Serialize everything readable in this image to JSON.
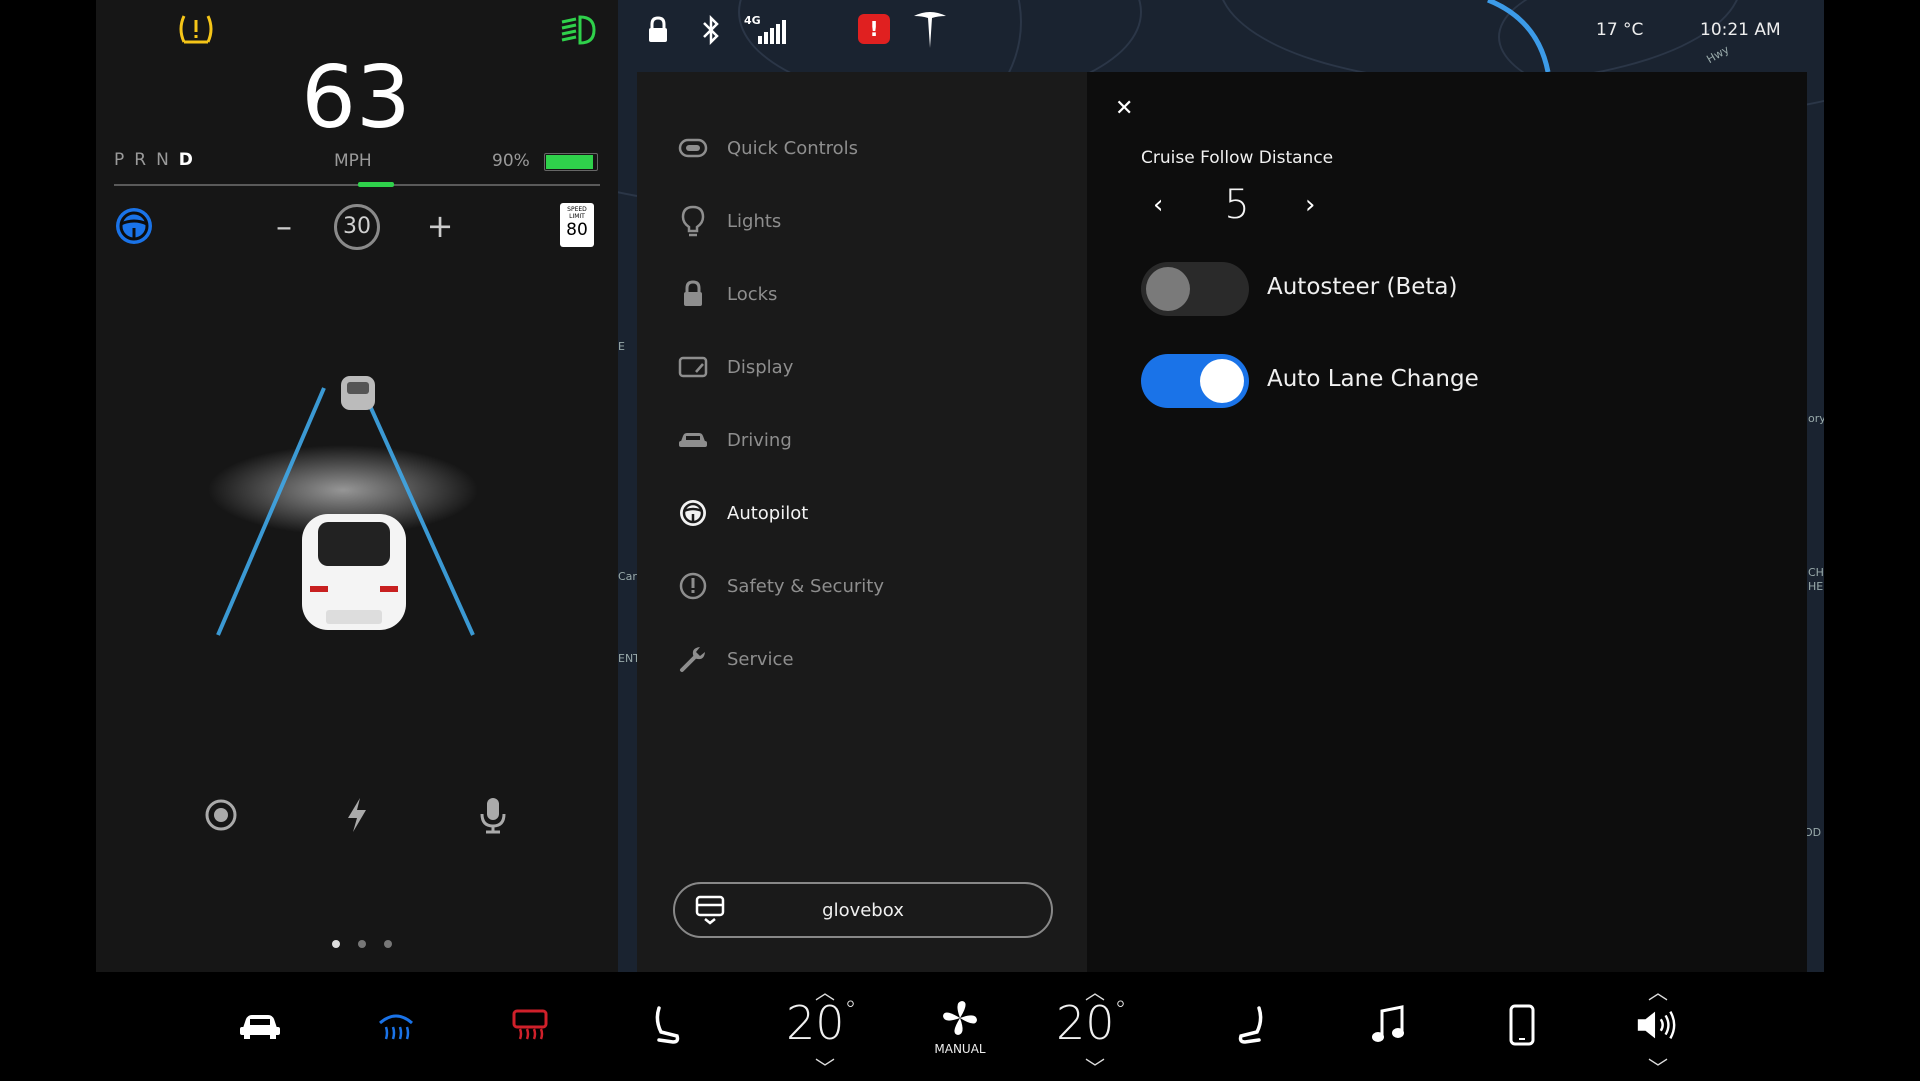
{
  "status_bar": {
    "network": "4G",
    "temperature": "17 °C",
    "time": "10:21 AM"
  },
  "cluster": {
    "speed": "63",
    "gear": {
      "p": "P",
      "r": "R",
      "n": "N",
      "d": "D"
    },
    "unit": "MPH",
    "battery_percent": "90%",
    "battery_level": 0.9,
    "set_speed": "30",
    "speed_limit_sign": {
      "line1": "SPEED",
      "line2": "LIMIT",
      "value": "80"
    },
    "decrease": "–",
    "increase": "+"
  },
  "map_labels": {
    "left1": "E",
    "left2": "Car",
    "left3": "ENT",
    "right1": "ory",
    "right2": "CH",
    "right3": "HE",
    "right4": "OD",
    "top": "Hwy"
  },
  "menu": {
    "items": [
      {
        "label": "Quick Controls",
        "icon": "quick-controls-icon"
      },
      {
        "label": "Lights",
        "icon": "bulb-icon"
      },
      {
        "label": "Locks",
        "icon": "lock-icon"
      },
      {
        "label": "Display",
        "icon": "display-icon"
      },
      {
        "label": "Driving",
        "icon": "car-icon"
      },
      {
        "label": "Autopilot",
        "icon": "steering-wheel-icon"
      },
      {
        "label": "Safety & Security",
        "icon": "alert-icon"
      },
      {
        "label": "Service",
        "icon": "wrench-icon"
      }
    ],
    "active": "Autopilot",
    "glovebox_label": "glovebox"
  },
  "autopilot": {
    "close": "✕",
    "follow_distance_label": "Cruise Follow Distance",
    "follow_distance_value": "5",
    "autosteer_label": "Autosteer (Beta)",
    "autosteer_on": false,
    "lane_change_label": "Auto Lane Change",
    "lane_change_on": true
  },
  "bottom_bar": {
    "driver_temp": "20",
    "passenger_temp": "20",
    "degree": "°",
    "fan_mode": "MANUAL"
  },
  "colors": {
    "accent": "#1a73e8",
    "battery": "#2fd14b",
    "warning": "#f5c518",
    "headlight": "#2fd14b",
    "alert": "#e02020",
    "defrost_rear": "#d0202a"
  }
}
